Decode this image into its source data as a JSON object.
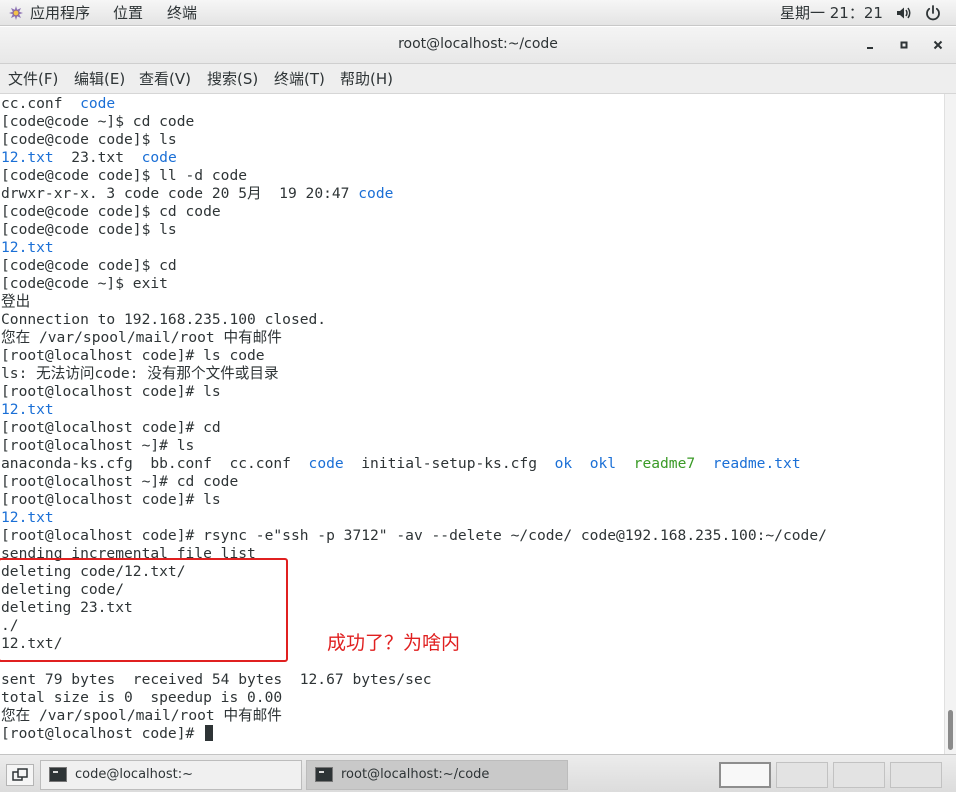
{
  "topbar": {
    "apps": "应用程序",
    "places": "位置",
    "terminal": "终端",
    "clock": "星期一 21：21"
  },
  "window": {
    "title": "root@localhost:~/code"
  },
  "menu": {
    "file": "文件(F)",
    "edit": "编辑(E)",
    "view": "查看(V)",
    "search": "搜索(S)",
    "terminal": "终端(T)",
    "help": "帮助(H)"
  },
  "terminal": {
    "lines": [
      [
        {
          "t": "cc.conf  "
        },
        {
          "t": "code",
          "c": "blue"
        }
      ],
      [
        {
          "t": "[code@code ~]$ cd code"
        }
      ],
      [
        {
          "t": "[code@code code]$ ls"
        }
      ],
      [
        {
          "t": "12.txt",
          "c": "blue"
        },
        {
          "t": "  23.txt  "
        },
        {
          "t": "code",
          "c": "blue"
        }
      ],
      [
        {
          "t": "[code@code code]$ ll -d code"
        }
      ],
      [
        {
          "t": "drwxr-xr-x. 3 code code 20 5月  19 20:47 "
        },
        {
          "t": "code",
          "c": "blue"
        }
      ],
      [
        {
          "t": "[code@code code]$ cd code"
        }
      ],
      [
        {
          "t": "[code@code code]$ ls"
        }
      ],
      [
        {
          "t": "12.txt",
          "c": "blue"
        }
      ],
      [
        {
          "t": "[code@code code]$ cd"
        }
      ],
      [
        {
          "t": "[code@code ~]$ exit"
        }
      ],
      [
        {
          "t": "登出"
        }
      ],
      [
        {
          "t": "Connection to 192.168.235.100 closed."
        }
      ],
      [
        {
          "t": "您在 /var/spool/mail/root 中有邮件"
        }
      ],
      [
        {
          "t": "[root@localhost code]# ls code"
        }
      ],
      [
        {
          "t": "ls: 无法访问code: 没有那个文件或目录"
        }
      ],
      [
        {
          "t": "[root@localhost code]# ls"
        }
      ],
      [
        {
          "t": "12.txt",
          "c": "blue"
        }
      ],
      [
        {
          "t": "[root@localhost code]# cd"
        }
      ],
      [
        {
          "t": "[root@localhost ~]# ls"
        }
      ],
      [
        {
          "t": "anaconda-ks.cfg  bb.conf  cc.conf  "
        },
        {
          "t": "code",
          "c": "blue"
        },
        {
          "t": "  initial-setup-ks.cfg  "
        },
        {
          "t": "ok",
          "c": "blue"
        },
        {
          "t": "  "
        },
        {
          "t": "okl",
          "c": "blue"
        },
        {
          "t": "  "
        },
        {
          "t": "readme7",
          "c": "green"
        },
        {
          "t": "  "
        },
        {
          "t": "readme.txt",
          "c": "blue"
        }
      ],
      [
        {
          "t": "[root@localhost ~]# cd code"
        }
      ],
      [
        {
          "t": "[root@localhost code]# ls"
        }
      ],
      [
        {
          "t": "12.txt",
          "c": "blue"
        }
      ],
      [
        {
          "t": "[root@localhost code]# rsync -e\"ssh -p 3712\" -av --delete ~/code/ code@192.168.235.100:~/code/"
        }
      ],
      [
        {
          "t": "sending incremental file list"
        }
      ],
      [
        {
          "t": "deleting code/12.txt/"
        }
      ],
      [
        {
          "t": "deleting code/"
        }
      ],
      [
        {
          "t": "deleting 23.txt"
        }
      ],
      [
        {
          "t": "./"
        }
      ],
      [
        {
          "t": "12.txt/"
        }
      ],
      [
        {
          "t": ""
        }
      ],
      [
        {
          "t": "sent 79 bytes  received 54 bytes  12.67 bytes/sec"
        }
      ],
      [
        {
          "t": "total size is 0  speedup is 0.00"
        }
      ],
      [
        {
          "t": "您在 /var/spool/mail/root 中有邮件"
        }
      ],
      [
        {
          "t": "[root@localhost code]# "
        }
      ]
    ]
  },
  "annotation": {
    "text": "成功了？为啥内"
  },
  "taskbar": {
    "tasks": [
      {
        "label": "code@localhost:~"
      },
      {
        "label": "root@localhost:~/code"
      }
    ]
  },
  "colors": {
    "blue": "#1a6fd6",
    "green": "#3a9a26",
    "annotation": "#e02020"
  }
}
